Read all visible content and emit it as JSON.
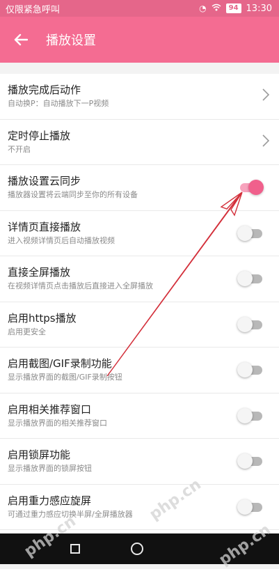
{
  "status_bar": {
    "carrier": "仅限紧急呼叫",
    "battery": "94",
    "time": "13:30",
    "icons": [
      "hd-icon",
      "wifi-icon",
      "battery-icon"
    ]
  },
  "app_bar": {
    "title": "播放设置",
    "back_icon": "back-arrow-icon",
    "color": "#f46c92"
  },
  "settings": [
    {
      "title": "播放完成后动作",
      "subtitle": "自动换P：自动播放下一P视频",
      "control": "chevron"
    },
    {
      "title": "定时停止播放",
      "subtitle": "不开启",
      "control": "chevron"
    },
    {
      "title": "播放设置云同步",
      "subtitle": "播放器设置将云端同步至你的所有设备",
      "control": "toggle",
      "on": true
    },
    {
      "title": "详情页直接播放",
      "subtitle": "进入视频详情页后自动播放视频",
      "control": "toggle",
      "on": false
    },
    {
      "title": "直接全屏播放",
      "subtitle": "在视频详情页点击播放后直接进入全屏播放",
      "control": "toggle",
      "on": false
    },
    {
      "title": "启用https播放",
      "subtitle": "启用更安全",
      "control": "toggle",
      "on": false
    },
    {
      "title": "启用截图/GIF录制功能",
      "subtitle": "显示播放界面的截图/GIF录制按钮",
      "control": "toggle",
      "on": false
    },
    {
      "title": "启用相关推荐窗口",
      "subtitle": "显示播放界面的相关推荐窗口",
      "control": "toggle",
      "on": false
    },
    {
      "title": "启用锁屏功能",
      "subtitle": "显示播放界面的锁屏按钮",
      "control": "toggle",
      "on": false
    },
    {
      "title": "启用重力感应旋屏",
      "subtitle": "可通过重力感应切换半屏/全屏播放器",
      "control": "toggle",
      "on": false
    }
  ],
  "nav_bar": {
    "icons": [
      "recents-square-icon",
      "home-circle-icon"
    ]
  },
  "annotation": {
    "shape": "red-arrow",
    "color": "#d32f3a",
    "points_to": "播放设置云同步"
  },
  "watermark": "php.cn"
}
